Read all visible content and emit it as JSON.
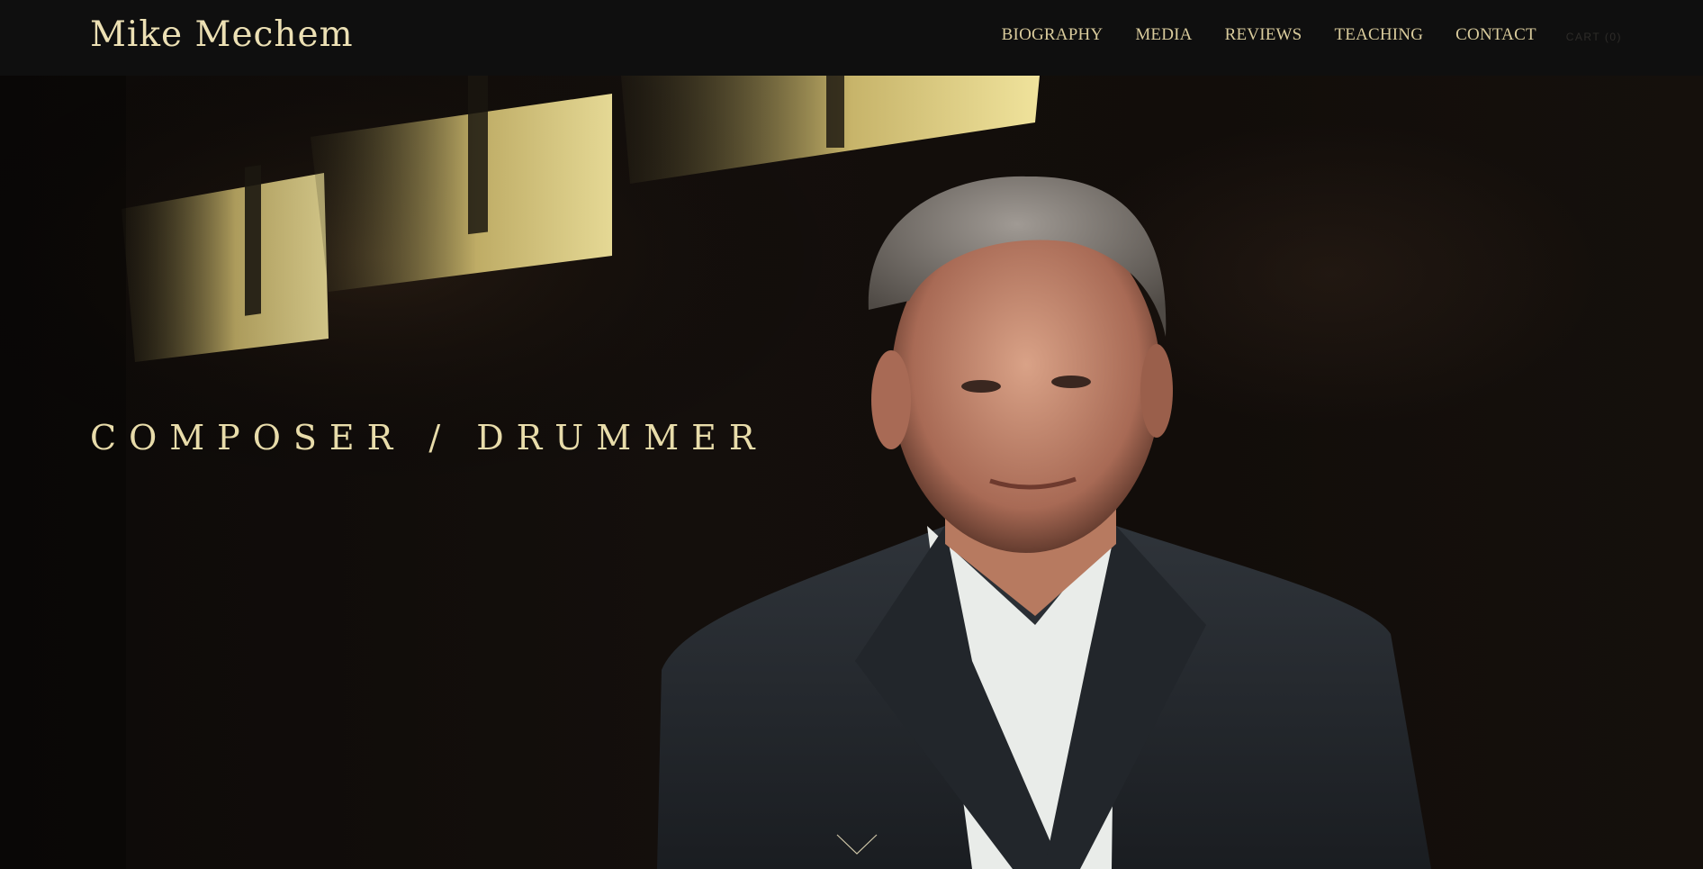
{
  "header": {
    "site_title": "Mike Mechem",
    "nav": [
      {
        "label": "BIOGRAPHY"
      },
      {
        "label": "MEDIA"
      },
      {
        "label": "REVIEWS"
      },
      {
        "label": "TEACHING"
      },
      {
        "label": "CONTACT"
      }
    ],
    "cart_label": "CART (0)"
  },
  "hero": {
    "tagline": "COMPOSER / DRUMMER",
    "scroll_icon": "chevron-down-icon"
  },
  "colors": {
    "header_bg": "#0f0f0f",
    "title_color": "#ece0b4",
    "nav_color": "#d9cb9c",
    "tagline_color": "#e8dcaa",
    "hero_bg": "#120d0a"
  }
}
